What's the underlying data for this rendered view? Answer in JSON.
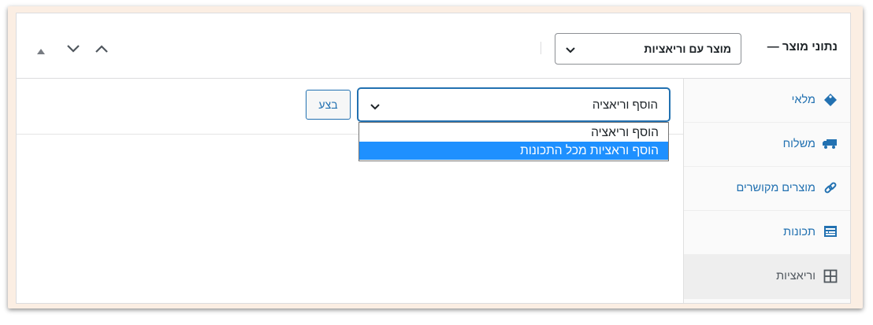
{
  "header": {
    "title": "נתוני מוצר —",
    "product_type": "מוצר עם וריאציות"
  },
  "tabs": [
    {
      "label": "מלאי",
      "icon": "tag-icon",
      "active": false
    },
    {
      "label": "משלוח",
      "icon": "truck-icon",
      "active": false
    },
    {
      "label": "מוצרים מקושרים",
      "icon": "link-icon",
      "active": false
    },
    {
      "label": "תכונות",
      "icon": "list-card-icon",
      "active": false
    },
    {
      "label": "וריאציות",
      "icon": "grid-icon",
      "active": true
    }
  ],
  "variations": {
    "action_select": "הוסף וריאציה",
    "go_button": "בצע",
    "options": [
      {
        "label": "הוסף וריאציה",
        "selected": false
      },
      {
        "label": "הוסף וראציות מכל התכונות",
        "selected": true
      }
    ]
  },
  "colors": {
    "accent": "#2271b1",
    "selected_option": "#1e90ff"
  }
}
